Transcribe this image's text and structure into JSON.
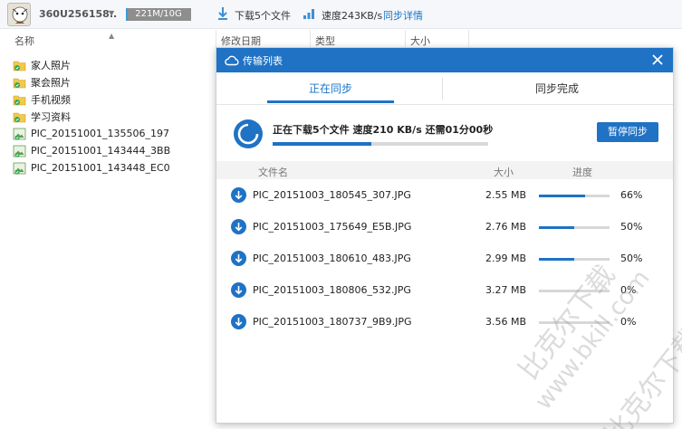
{
  "topbar": {
    "username": "360U256158..",
    "quota_text": "221M/10G",
    "quota_used_fraction": 0.03,
    "download_status": "下载5个文件",
    "speed": "速度243KB/s",
    "sync_details_link": "同步详情"
  },
  "file_browser": {
    "columns": {
      "name": "名称",
      "modified": "修改日期",
      "type": "类型",
      "size": "大小"
    },
    "items": [
      {
        "name": "家人照片",
        "icon": "sync-folder-icon"
      },
      {
        "name": "聚会照片",
        "icon": "sync-folder-icon"
      },
      {
        "name": "手机视频",
        "icon": "sync-folder-icon"
      },
      {
        "name": "学习资料",
        "icon": "sync-folder-icon"
      },
      {
        "name": "PIC_20151001_135506_197",
        "icon": "image-file-icon"
      },
      {
        "name": "PIC_20151001_143444_3BB",
        "icon": "image-file-icon"
      },
      {
        "name": "PIC_20151001_143448_EC0",
        "icon": "image-file-icon"
      }
    ]
  },
  "dialog": {
    "title": "传输列表",
    "tabs": {
      "syncing": "正在同步",
      "done": "同步完成"
    },
    "status_text": "正在下载5个文件  速度210 KB/s  还需01分00秒",
    "overall_progress": 0.46,
    "pause_button": "暂停同步",
    "table_headers": {
      "filename": "文件名",
      "size": "大小",
      "progress": "进度"
    },
    "transfers": [
      {
        "name": "PIC_20151003_180545_307.JPG",
        "size": "2.55 MB",
        "percent": "66%",
        "progress": 0.66
      },
      {
        "name": "PIC_20151003_175649_E5B.JPG",
        "size": "2.76 MB",
        "percent": "50%",
        "progress": 0.5
      },
      {
        "name": "PIC_20151003_180610_483.JPG",
        "size": "2.99 MB",
        "percent": "50%",
        "progress": 0.5
      },
      {
        "name": "PIC_20151003_180806_532.JPG",
        "size": "3.27 MB",
        "percent": "0%",
        "progress": 0
      },
      {
        "name": "PIC_20151003_180737_9B9.JPG",
        "size": "3.56 MB",
        "percent": "0%",
        "progress": 0
      }
    ]
  },
  "watermark": {
    "text_cn": "比克尔下载",
    "text_url": "www.bkill.com"
  },
  "colors": {
    "accent": "#1f72c4",
    "quota_fill": "#3c9ad7",
    "link": "#1a73c8"
  }
}
